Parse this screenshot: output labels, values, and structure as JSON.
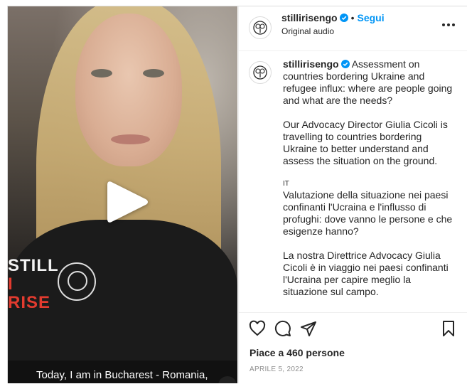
{
  "video": {
    "shirt_line1": "STILL",
    "shirt_line2": "I RISE",
    "caption": "Today, I am in Bucharest - Romania,"
  },
  "header": {
    "username": "stillirisengo",
    "dot": "•",
    "follow_label": "Segui",
    "audio": "Original audio"
  },
  "caption": {
    "username": "stillirisengo",
    "paragraphs": [
      "Assessment on countries bordering Ukraine and refugee influx: where are people going and what are the needs?",
      "Our Advocacy Director Giulia Cicoli is travelling to countries bordering Ukraine to better understand and assess the situation on the ground.",
      "IT",
      "Valutazione della situazione nei paesi confinanti l'Ucraina e l'influsso di profughi: dove vanno le persone e che esigenze hanno?",
      "La nostra Direttrice Advocacy Giulia Cicoli è in viaggio nei paesi confinanti l'Ucraina per capire meglio la situazione sul campo."
    ]
  },
  "actions": {
    "likes": "Piace a 460 persone",
    "date": "APRILE 5, 2022"
  },
  "colors": {
    "accent": "#0095f6",
    "verified": "#0095f6",
    "text": "#262626",
    "muted": "#8e8e8e"
  },
  "icons": [
    "play-icon",
    "volume-icon",
    "verified-icon",
    "more-icon",
    "heart-icon",
    "comment-icon",
    "share-icon",
    "bookmark-icon"
  ]
}
